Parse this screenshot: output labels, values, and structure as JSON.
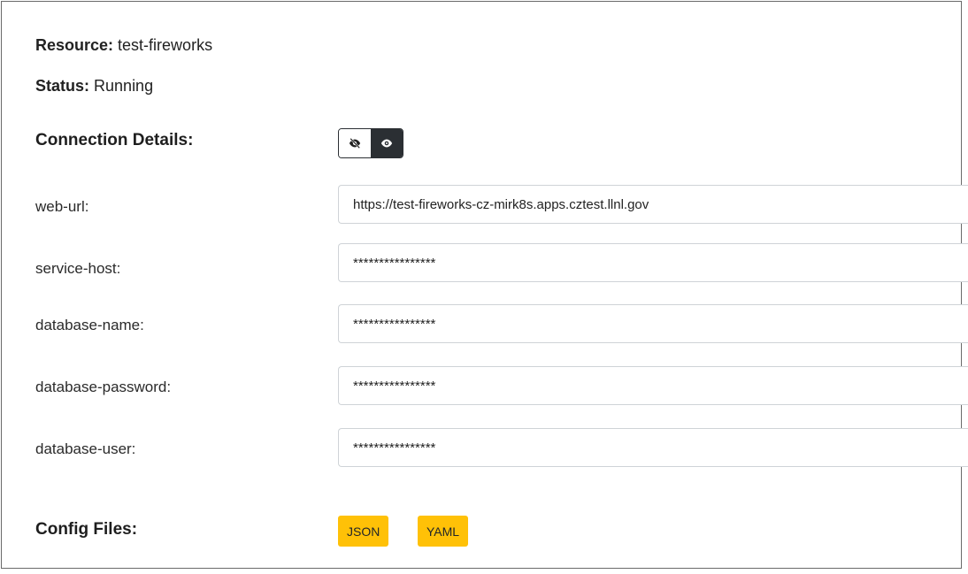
{
  "resource": {
    "label": "Resource:",
    "value": "test-fireworks"
  },
  "status": {
    "label": "Status:",
    "value": "Running"
  },
  "connection_details": {
    "label": "Connection Details:",
    "toggle": {
      "hide_icon": "eye-slash-icon",
      "show_icon": "eye-icon",
      "active": "show"
    },
    "fields": [
      {
        "label": "web-url:",
        "value": "https://test-fireworks-cz-mirk8s.apps.cztest.llnl.gov"
      },
      {
        "label": "service-host:",
        "value": "****************"
      },
      {
        "label": "database-name:",
        "value": "****************"
      },
      {
        "label": "database-password:",
        "value": "****************"
      },
      {
        "label": "database-user:",
        "value": "****************"
      }
    ]
  },
  "config_files": {
    "label": "Config Files:",
    "json_label": "JSON",
    "yaml_label": "YAML"
  },
  "colors": {
    "accent": "#ffc107",
    "toggle_active": "#2b2f33",
    "input_border": "#cfd3d7"
  }
}
